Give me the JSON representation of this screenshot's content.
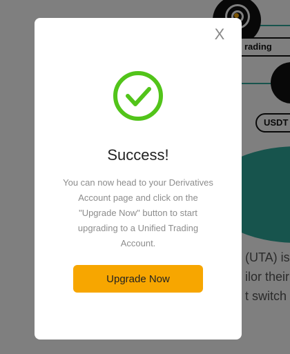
{
  "background": {
    "pill_1_label": "rading",
    "pill_2_label": "USDT",
    "text_line_1": "(UTA) is",
    "text_line_2": "ilor their",
    "text_line_3": "t switch"
  },
  "modal": {
    "close_glyph": "X",
    "icon": "success-check-icon",
    "title": "Success!",
    "message": "You can now head to your Derivatives Account page and click on the \"Upgrade Now\" button to start upgrading to a Unified Trading Account.",
    "button_label": "Upgrade Now"
  },
  "colors": {
    "accent": "#f7a600",
    "success": "#52c41a",
    "teal": "#2ea89a"
  }
}
